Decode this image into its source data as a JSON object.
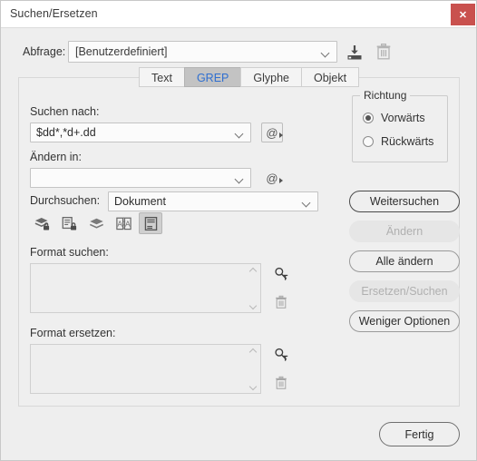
{
  "window": {
    "title": "Suchen/Ersetzen",
    "close_label": "✕"
  },
  "query": {
    "label": "Abfrage:",
    "value": "[Benutzerdefiniert]",
    "save_icon": "save-query-icon",
    "delete_icon": "delete-query-icon"
  },
  "tabs": [
    {
      "label": "Text",
      "active": false
    },
    {
      "label": "GREP",
      "active": true
    },
    {
      "label": "Glyphe",
      "active": false
    },
    {
      "label": "Objekt",
      "active": false
    }
  ],
  "find": {
    "label": "Suchen nach:",
    "value": "$dd*,*d+.dd",
    "special_button": "@"
  },
  "change": {
    "label": "Ändern in:",
    "value": "",
    "special_button": "@"
  },
  "search_scope": {
    "label": "Durchsuchen:",
    "value": "Dokument",
    "icons": [
      {
        "name": "include-locked-layers-icon",
        "selected": false
      },
      {
        "name": "include-locked-stories-icon",
        "selected": false
      },
      {
        "name": "include-hidden-layers-icon",
        "selected": false
      },
      {
        "name": "include-master-pages-icon",
        "selected": false
      },
      {
        "name": "include-footnotes-icon",
        "selected": true
      }
    ]
  },
  "format_find": {
    "label": "Format suchen:",
    "value": "",
    "settings_icon": "format-settings-icon",
    "clear_icon": "clear-format-icon"
  },
  "format_change": {
    "label": "Format ersetzen:",
    "value": "",
    "settings_icon": "format-settings-icon",
    "clear_icon": "clear-format-icon"
  },
  "direction": {
    "title": "Richtung",
    "options": [
      {
        "label": "Vorwärts",
        "checked": true
      },
      {
        "label": "Rückwärts",
        "checked": false
      }
    ]
  },
  "actions": [
    {
      "label": "Weitersuchen",
      "state": "primary"
    },
    {
      "label": "Ändern",
      "state": "disabled"
    },
    {
      "label": "Alle ändern",
      "state": "normal"
    },
    {
      "label": "Ersetzen/Suchen",
      "state": "disabled"
    },
    {
      "label": "Weniger Optionen",
      "state": "normal"
    }
  ],
  "footer": {
    "done_label": "Fertig"
  },
  "colors": {
    "accent_tab": "#2f6fd0",
    "close_button": "#c9514e",
    "panel_bg": "#efefef",
    "window_bg": "#eeeeee"
  }
}
